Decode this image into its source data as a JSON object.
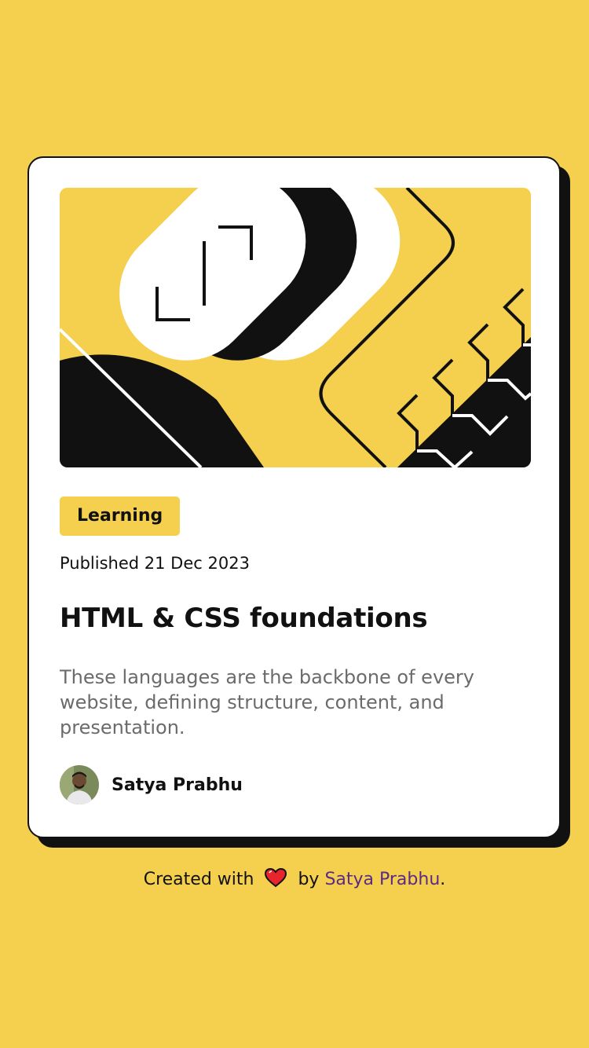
{
  "card": {
    "tag": "Learning",
    "published": "Published 21 Dec 2023",
    "title": "HTML & CSS foundations",
    "description": "These languages are the backbone of every website, defining structure, content, and presentation.",
    "author": {
      "name": "Satya Prabhu",
      "avatar_icon": "avatar-photo"
    }
  },
  "footer": {
    "prefix": "Created with",
    "heart_icon": "heart-icon",
    "by_text": "by",
    "link_text": "Satya Prabhu",
    "suffix": "."
  },
  "colors": {
    "background": "#F4D04E",
    "card": "#FFFFFF",
    "ink": "#111111",
    "muted_text": "#6B6B6B",
    "link": "#5B2A86",
    "heart": "#E8242C"
  }
}
